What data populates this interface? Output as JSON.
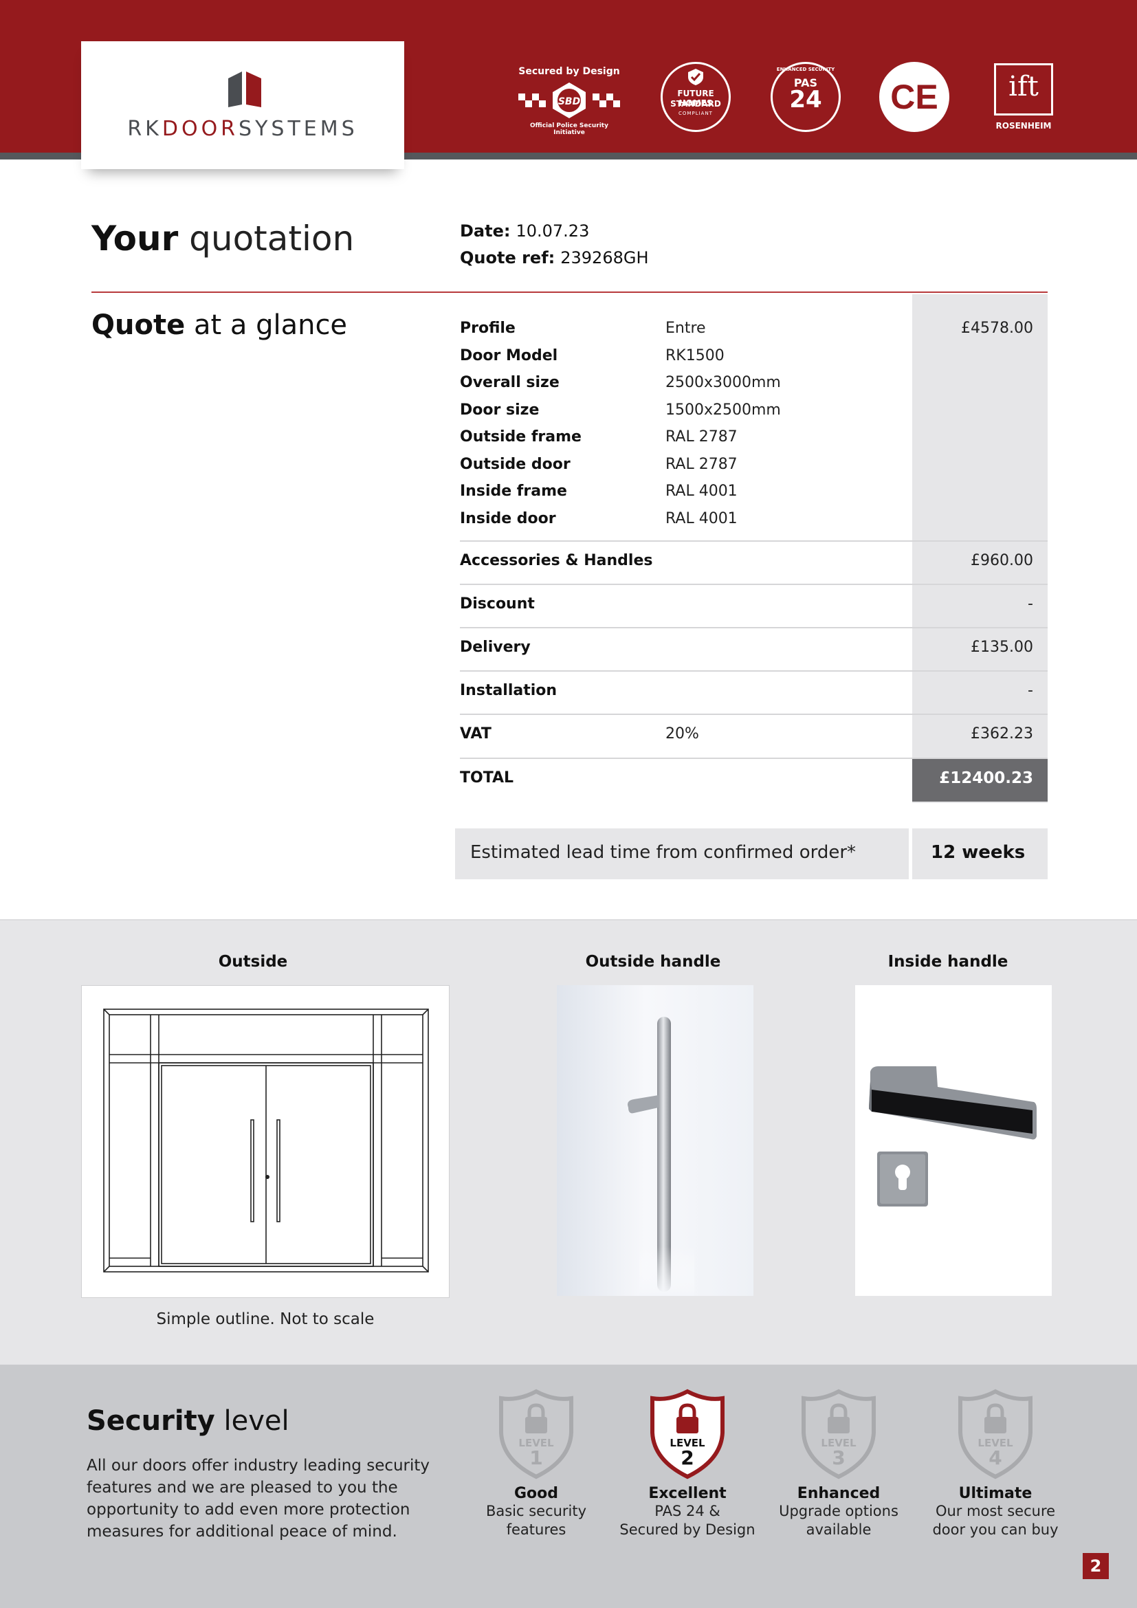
{
  "header": {
    "logo_prefix": "RK",
    "logo_mid": "DOOR",
    "logo_suffix": "SYSTEMS",
    "badges": {
      "sbd_title": "Secured by Design",
      "sbd_mark": "SBD",
      "sbd_sub": "Official Police Security Initiative",
      "fhs_line1": "FUTURE HOMES",
      "fhs_line2": "STANDARD",
      "fhs_line3": "COMPLIANT",
      "pas_top": "ENHANCED SECURITY",
      "pas_label": "PAS",
      "pas_num": "24",
      "ce": "CE",
      "ift": "ift",
      "ift_sub": "ROSENHEIM"
    }
  },
  "title": {
    "bold": "Your",
    "light": "quotation"
  },
  "meta": {
    "date_label": "Date:",
    "date_value": "10.07.23",
    "ref_label": "Quote ref:",
    "ref_value": "239268GH"
  },
  "glance": {
    "bold": "Quote",
    "light": "at a glance"
  },
  "spec_rows": [
    {
      "label": "Profile",
      "value": "Entre",
      "price": "£4578.00"
    },
    {
      "label": "Door Model",
      "value": "RK1500"
    },
    {
      "label": "Overall size",
      "value": "2500x3000mm"
    },
    {
      "label": "Door size",
      "value": "1500x2500mm"
    },
    {
      "label": "Outside frame",
      "value": "RAL 2787"
    },
    {
      "label": "Outside door",
      "value": "RAL 2787"
    },
    {
      "label": "Inside frame",
      "value": "RAL 4001"
    },
    {
      "label": "Inside door",
      "value": "RAL 4001"
    }
  ],
  "cost_rows": [
    {
      "label": "Accessories & Handles",
      "value": "",
      "price": "£960.00"
    },
    {
      "label": "Discount",
      "value": "",
      "price": "-"
    },
    {
      "label": "Delivery",
      "value": "",
      "price": "£135.00"
    },
    {
      "label": "Installation",
      "value": "",
      "price": "-"
    },
    {
      "label": "VAT",
      "value": "20%",
      "price": "£362.23"
    }
  ],
  "total": {
    "label": "TOTAL",
    "price": "£12400.23"
  },
  "lead_time": {
    "label": "Estimated lead time from confirmed order*",
    "value": "12 weeks"
  },
  "images": {
    "outside_caption": "Outside",
    "outside_handle_caption": "Outside handle",
    "inside_handle_caption": "Inside handle",
    "outline_note": "Simple outline. Not to scale"
  },
  "security": {
    "title_bold": "Security",
    "title_light": "level",
    "body": "All our doors offer industry leading security features and we are pleased to you the opportunity to add even more protection measures for additional peace of mind.",
    "level_word": "LEVEL",
    "levels": [
      {
        "num": "1",
        "name": "Good",
        "desc1": "Basic security",
        "desc2": "features",
        "active": false
      },
      {
        "num": "2",
        "name": "Excellent",
        "desc1": "PAS 24 &",
        "desc2": "Secured by Design",
        "active": true
      },
      {
        "num": "3",
        "name": "Enhanced",
        "desc1": "Upgrade options",
        "desc2": "available",
        "active": false
      },
      {
        "num": "4",
        "name": "Ultimate",
        "desc1": "Our most secure",
        "desc2": "door you can buy",
        "active": false
      }
    ]
  },
  "page_number": "2",
  "colors": {
    "brand_red": "#951a1d",
    "header_stripe": "#55585c",
    "table_grey": "#e6e6e8",
    "total_grey": "#6a6a6d",
    "security_grey": "#c8c9cc"
  }
}
